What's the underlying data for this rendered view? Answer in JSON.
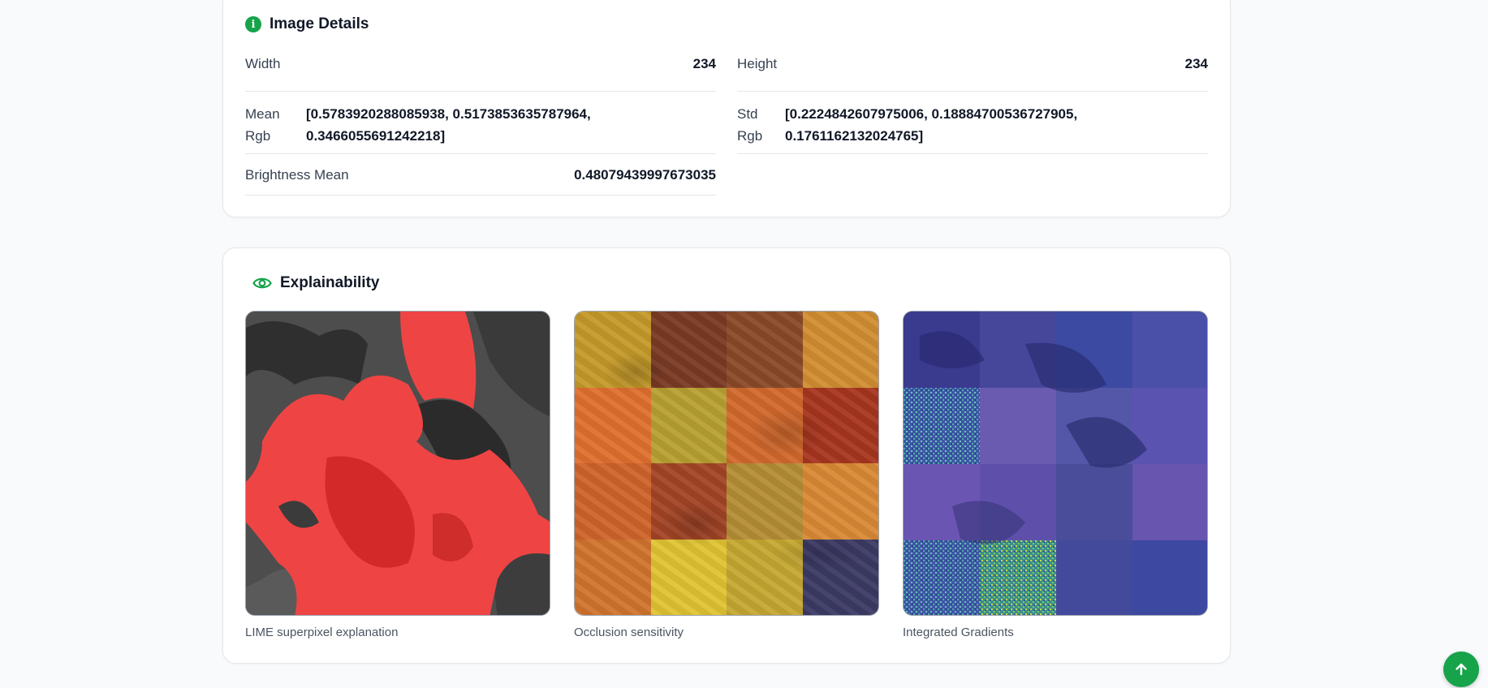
{
  "image_details": {
    "title": "Image Details",
    "width_label": "Width",
    "width_value": "234",
    "height_label": "Height",
    "height_value": "234",
    "mean_rgb_label_1": "Mean",
    "mean_rgb_label_2": "Rgb",
    "mean_rgb_value_1": "[0.5783920288085938, 0.5173853635787964,",
    "mean_rgb_value_2": "0.3466055691242218]",
    "std_rgb_label_1": "Std",
    "std_rgb_label_2": "Rgb",
    "std_rgb_value_1": "[0.2224842607975006, 0.18884700536727905,",
    "std_rgb_value_2": "0.1761162132024765]",
    "brightness_label": "Brightness Mean",
    "brightness_value": "0.48079439997673035"
  },
  "explainability": {
    "title": "Explainability",
    "items": [
      {
        "caption": "LIME superpixel explanation"
      },
      {
        "caption": "Occlusion sensitivity"
      },
      {
        "caption": "Integrated Gradients"
      }
    ]
  },
  "icons": {
    "info": "info-icon",
    "eye": "eye-icon",
    "scroll_top": "arrow-up-icon"
  },
  "colors": {
    "accent": "#16a34a"
  }
}
